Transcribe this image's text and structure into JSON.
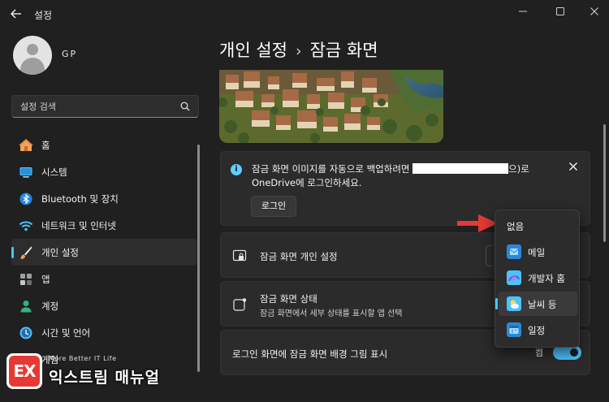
{
  "window": {
    "title": "설정",
    "back_glyph": "←",
    "controls": {
      "minimize": "—",
      "maximize": "☐",
      "close": "✕"
    }
  },
  "user": {
    "name": "GP"
  },
  "search": {
    "placeholder": "설정 검색",
    "value": ""
  },
  "sidebar": {
    "items": [
      {
        "label": "홈",
        "icon": "home-icon",
        "active": false
      },
      {
        "label": "시스템",
        "icon": "monitor-icon",
        "active": false
      },
      {
        "label": "Bluetooth 및 장치",
        "icon": "bluetooth-icon",
        "active": false
      },
      {
        "label": "네트워크 및 인터넷",
        "icon": "wifi-icon",
        "active": false
      },
      {
        "label": "개인 설정",
        "icon": "brush-icon",
        "active": true
      },
      {
        "label": "앱",
        "icon": "apps-icon",
        "active": false
      },
      {
        "label": "계정",
        "icon": "person-icon",
        "active": false
      },
      {
        "label": "시간 및 언어",
        "icon": "globe-clock-icon",
        "active": false
      },
      {
        "label": "게임",
        "icon": "gamepad-icon",
        "active": false
      }
    ]
  },
  "breadcrumb": {
    "parent": "개인 설정",
    "separator": "›",
    "current": "잠금 화면"
  },
  "infobar": {
    "icon": "info-icon",
    "text_before": "잠금 화면 이미지를 자동으로 백업하려면 ",
    "text_after": "으)로",
    "text_line2": "OneDrive에 로그인하세요.",
    "close_glyph": "✕",
    "login_label": "로그인"
  },
  "settings": {
    "personalize": {
      "title": "잠금 화면 개인 설정",
      "icon": "lock-screen-icon"
    },
    "status": {
      "title": "잠금 화면 상태",
      "subtitle": "잠금 화면에서 세부 상태를 표시할 앱 선택",
      "icon": "status-icon"
    },
    "signin_background": {
      "title": "로그인 화면에 잠금 화면 배경 그림 표시",
      "toggle_label": "켬",
      "toggle_on": true
    }
  },
  "dropdown": {
    "options": [
      {
        "label": "없음",
        "icon": "",
        "selected": false
      },
      {
        "label": "메일",
        "icon": "mail-icon",
        "selected": false
      },
      {
        "label": "개발자 홈",
        "icon": "dev-home-icon",
        "selected": false
      },
      {
        "label": "날씨 등",
        "icon": "weather-icon",
        "selected": true
      },
      {
        "label": "일정",
        "icon": "calendar-icon",
        "selected": false
      }
    ]
  },
  "watermark": {
    "logo_text": "EX",
    "tagline": "More Better IT Life",
    "name": "익스트림 매뉴얼"
  },
  "colors": {
    "accent": "#4cc2ff",
    "background": "#202020",
    "card": "#2b2b2b",
    "arrow": "#e53935"
  }
}
